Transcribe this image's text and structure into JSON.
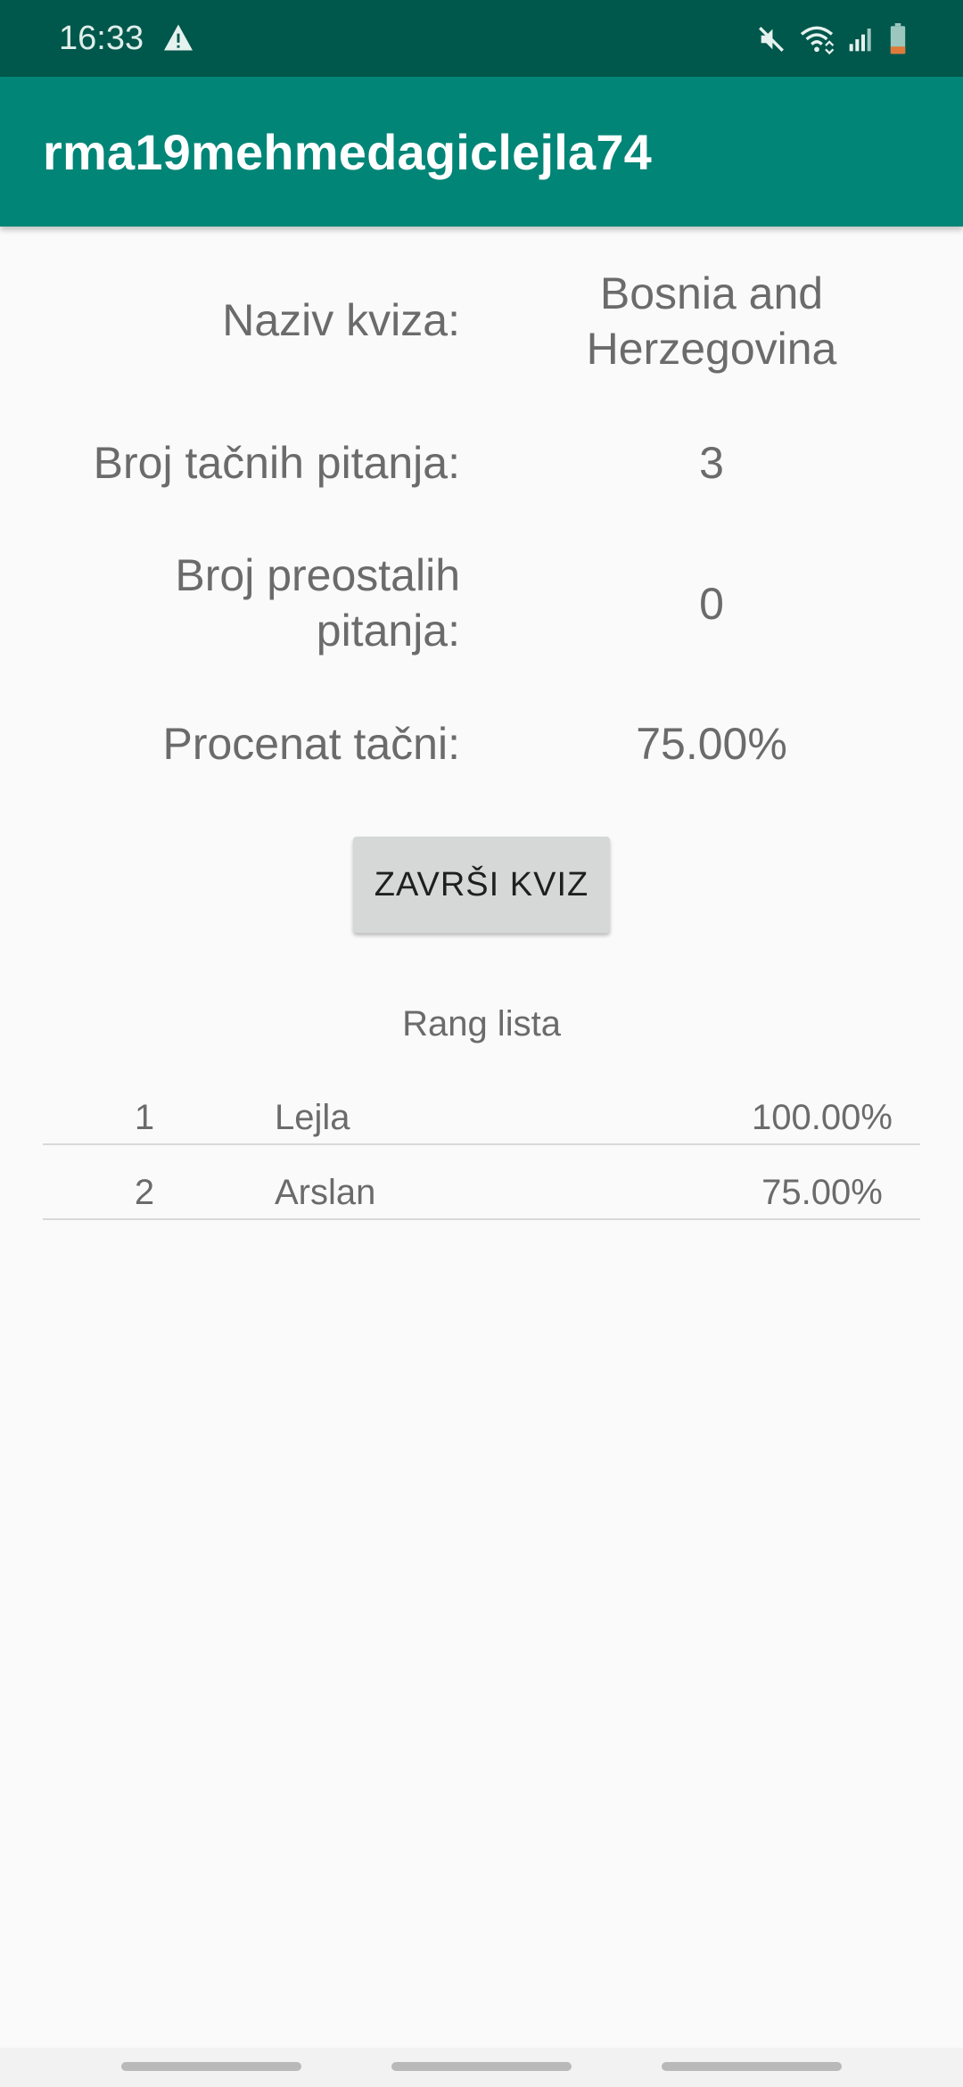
{
  "status_bar": {
    "time": "16:33",
    "icons": [
      "warning-icon",
      "mute-icon",
      "wifi-icon",
      "signal-icon",
      "battery-icon"
    ],
    "background": "#00574b"
  },
  "app_bar": {
    "title": "rma19mehmedagiclejla74",
    "background": "#008577"
  },
  "stats": [
    {
      "label": "Naziv kviza:",
      "value": "Bosnia and Herzegovina"
    },
    {
      "label": "Broj tačnih pitanja:",
      "value": "3"
    },
    {
      "label": "Broj preostalih pitanja:",
      "value": "0"
    },
    {
      "label": "Procenat tačni:",
      "value": "75.00%"
    }
  ],
  "finish_button": {
    "label": "ZAVRŠI KVIZ"
  },
  "ranking": {
    "title": "Rang lista",
    "rows": [
      {
        "position": "1",
        "name": "Lejla",
        "percent": "100.00%"
      },
      {
        "position": "2",
        "name": "Arslan",
        "percent": "75.00%"
      }
    ]
  }
}
